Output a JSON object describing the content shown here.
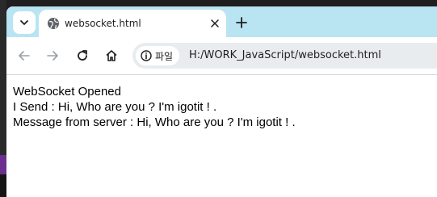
{
  "browser": {
    "tab": {
      "title": "websocket.html",
      "favicon": "globe-icon"
    },
    "toolbar": {
      "back_icon": "arrow-left-icon",
      "forward_icon": "arrow-right-icon",
      "reload_icon": "reload-icon",
      "home_icon": "home-icon"
    },
    "omnibox": {
      "site_info_label": "파일",
      "url": "H:/WORK_JavaScript/websocket.html"
    },
    "colors": {
      "tabstrip": "#b9e4f2",
      "omnibox": "#e9ecef"
    }
  },
  "page": {
    "lines": [
      "WebSocket Opened",
      "I Send : Hi, Who are you ? I'm igotit ! .",
      "Message from server : Hi, Who are you ? I'm igotit ! ."
    ]
  }
}
